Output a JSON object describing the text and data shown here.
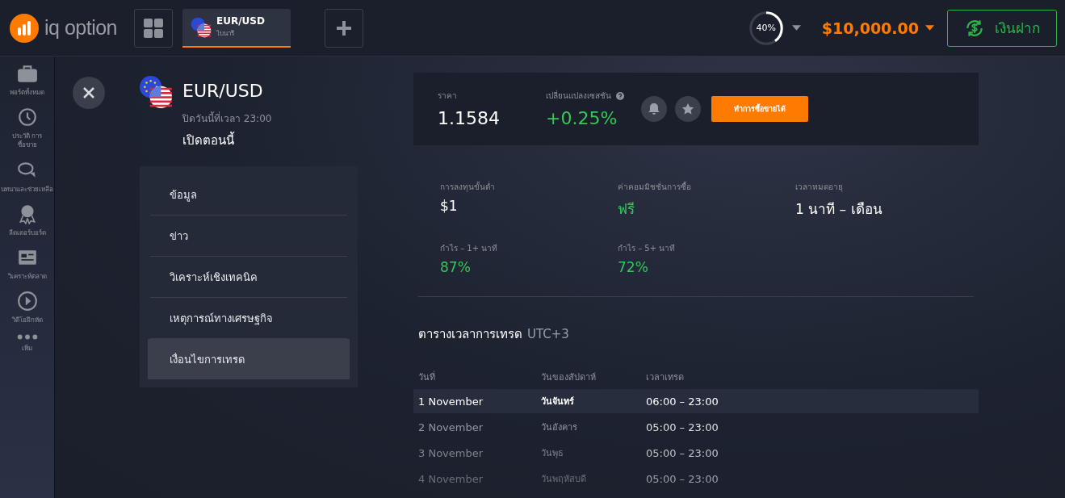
{
  "topbar": {
    "logo_text": "iq option",
    "asset_tab": {
      "name": "EUR/USD",
      "type": "ไบนารี",
      "selected": true
    },
    "progress": {
      "label": "40%",
      "level": 0.4
    },
    "balance": "$10,000.00",
    "deposit_button": "เงินฝาก"
  },
  "sidebar": {
    "items": [
      {
        "kind": "briefcase",
        "label": "พอร์ตทั้งหมด"
      },
      {
        "kind": "history",
        "label": "ประวัติ การซื้อขาย"
      },
      {
        "kind": "chat",
        "label": "นทนาและช่วยเหลือ"
      },
      {
        "kind": "medal",
        "label": "ลีดเดอร์บอร์ด"
      },
      {
        "kind": "news",
        "label": "วิเคราะห์ตลาด"
      },
      {
        "kind": "play",
        "label": "วิดีโอฝึกหัด"
      },
      {
        "kind": "more",
        "label": "เพิ่ม"
      }
    ]
  },
  "asset": {
    "name": "EUR/USD",
    "closing_note": "ปิดวันนี้ที่เวลา 23:00",
    "status": "เปิดตอนนี้"
  },
  "menu": [
    {
      "label": "ข้อมูล",
      "selected": false
    },
    {
      "label": "ข่าว",
      "selected": false
    },
    {
      "label": "วิเคราะห์เชิงเทคนิค",
      "selected": false
    },
    {
      "label": "เหตุการณ์ทางเศรษฐกิจ",
      "selected": false
    },
    {
      "label": "เงื่อนไขการเทรด",
      "selected": true
    }
  ],
  "quote": {
    "price_label": "ราคา",
    "price": "1.1584",
    "change_label": "เปลี่ยนแปลงเซสชัน",
    "change": "+0.25%",
    "trade_button": "ทำการซื้อขายได้"
  },
  "stats": [
    {
      "label": "การลงทุนขั้นต่ำ",
      "value": "$1",
      "positive": false
    },
    {
      "label": "ค่าคอมมิชชั่นการซื้อ",
      "value": "ฟรี",
      "positive": true
    },
    {
      "label": "เวลาหมดอายุ",
      "value": "1 นาที – เดือน",
      "positive": false
    },
    {
      "label": "กำไร – 1+ นาที",
      "value": "87%",
      "positive": true
    },
    {
      "label": "กำไร – 5+ นาที",
      "value": "72%",
      "positive": true
    }
  ],
  "schedule": {
    "title": "ตารางเวลาการเทรด",
    "timezone": "UTC+3",
    "columns": [
      "วันที่",
      "วันของสัปดาห์",
      "เวลาเทรด"
    ],
    "rows": [
      {
        "date": "1 November",
        "weekday": "วันจันทร์",
        "hours": "06:00 – 23:00",
        "selected": true
      },
      {
        "date": "2 November",
        "weekday": "วันอังคาร",
        "hours": "05:00 – 23:00",
        "selected": false
      },
      {
        "date": "3 November",
        "weekday": "วันพุธ",
        "hours": "05:00 – 23:00",
        "selected": false
      },
      {
        "date": "4 November",
        "weekday": "วันพฤหัสบดี",
        "hours": "05:00 – 23:00",
        "selected": false
      }
    ]
  }
}
